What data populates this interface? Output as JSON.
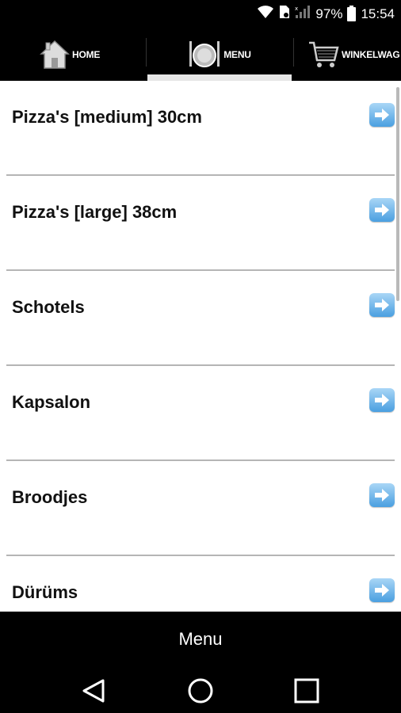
{
  "status_bar": {
    "battery_percent": "97%",
    "time": "15:54",
    "icons": [
      "wifi-icon",
      "sim-card-icon",
      "signal-icon",
      "battery-icon"
    ]
  },
  "nav": {
    "tabs": [
      {
        "label": "HOME",
        "icon": "house-icon"
      },
      {
        "label": "MENU",
        "icon": "plate-cutlery-icon",
        "active": true
      },
      {
        "label": "WINKELWAG",
        "icon": "shopping-cart-icon"
      }
    ]
  },
  "menu": {
    "items": [
      {
        "label": "Pizza's [medium] 30cm"
      },
      {
        "label": "Pizza's [large] 38cm"
      },
      {
        "label": "Schotels"
      },
      {
        "label": "Kapsalon"
      },
      {
        "label": "Broodjes"
      },
      {
        "label": "Dürüms"
      }
    ],
    "arrow_icon": "arrow-right-icon"
  },
  "footer": {
    "title": "Menu"
  },
  "android_nav": {
    "icons": [
      "back-icon",
      "home-circle-icon",
      "recents-icon"
    ]
  },
  "colors": {
    "arrow_top": "#a9d6f6",
    "arrow_bottom": "#4a9fe0"
  }
}
